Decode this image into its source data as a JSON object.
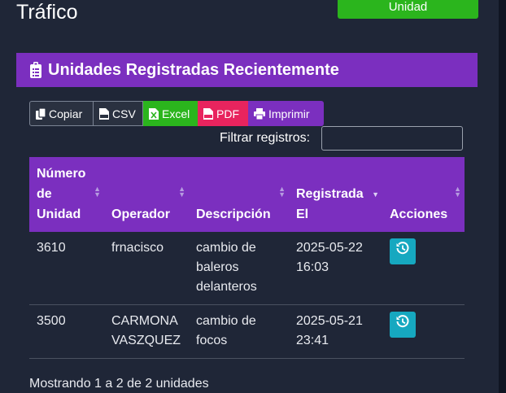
{
  "page": {
    "title": "Tráfico",
    "add_button": "Unidad"
  },
  "card": {
    "title": "Unidades Registradas Recientemente"
  },
  "toolbar": {
    "copy": "Copiar",
    "csv": "CSV",
    "excel": "Excel",
    "pdf": "PDF",
    "print": "Imprimir"
  },
  "filter": {
    "label": "Filtrar registros:",
    "value": ""
  },
  "table": {
    "columns": [
      "Número de Unidad",
      "Operador",
      "Descripción",
      "Registrada El",
      "Acciones"
    ],
    "rows": [
      {
        "unidad": "3610",
        "operador": "frnacisco",
        "descripcion": "cambio de baleros delanteros",
        "registrada": "2025-05-22 16:03"
      },
      {
        "unidad": "3500",
        "operador": "CARMONA VASZQUEZ",
        "descripcion": "cambio de focos",
        "registrada": "2025-05-21 23:41"
      }
    ]
  },
  "info": "Mostrando 1 a 2 de 2 unidades",
  "colors": {
    "background": "#1f2637",
    "accent": "#7b2fbf",
    "success": "#2bb51d",
    "danger": "#e8245e",
    "info": "#16a8c0"
  }
}
